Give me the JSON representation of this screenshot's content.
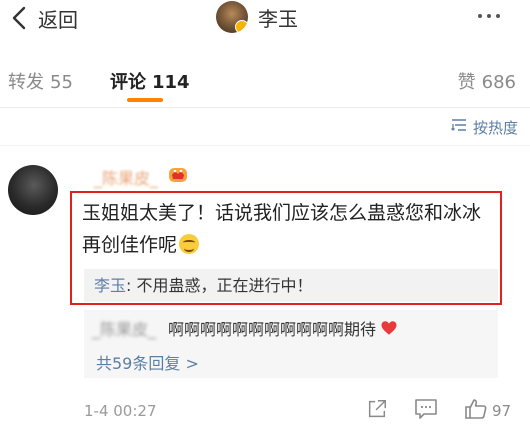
{
  "header": {
    "back_label": "返回",
    "title": "李玉"
  },
  "tabs": {
    "repost": {
      "label": "转发",
      "count": "55"
    },
    "comment": {
      "label": "评论",
      "count": "114"
    },
    "like": {
      "label": "赞",
      "count": "686"
    }
  },
  "sort": {
    "label": "按热度"
  },
  "comment": {
    "text": "玉姐姐太美了！话说我们应该怎么蛊惑您和冰冰再创佳作呢",
    "username": "_陈果皮_",
    "replies": [
      {
        "user": "李玉",
        "text": ": 不用蛊惑，正在进行中！"
      },
      {
        "user": "_陈果皮_",
        "text": "啊啊啊啊啊啊啊啊啊啊啊期待"
      }
    ],
    "more_replies": "共59条回复 >",
    "time": "1-4 00:27",
    "like_count": "97"
  },
  "colors": {
    "accent": "#ff8200",
    "link": "#5d7fa5",
    "highlight_border": "#e0221d"
  }
}
